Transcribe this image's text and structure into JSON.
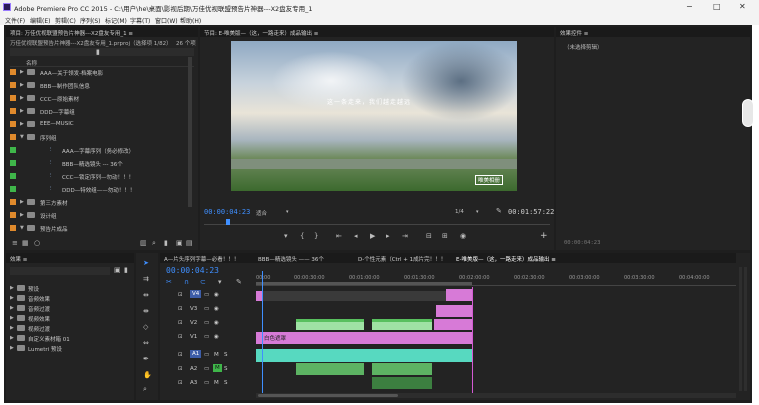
{
  "window": {
    "title": "Adobe Premiere Pro CC 2015 - C:\\用户\\he\\桌面\\影视后期\\万佳优视联盟预告片神器---X2盘友专用_1",
    "buttons": [
      "−",
      "□",
      "✕"
    ]
  },
  "menu": [
    "文件(F)",
    "编辑(E)",
    "剪辑(C)",
    "序列(S)",
    "标记(M)",
    "字幕(T)",
    "窗口(W)",
    "帮助(H)"
  ],
  "project": {
    "tab": "项目: 万佳优视联盟预告片神器---X2盘友专用_1 ≡",
    "file": "万佳优视联盟预告片神器---X2盘友专用_1.prproj（选择项 1/82）",
    "count": "26 个项",
    "column": "名称",
    "items": [
      {
        "label": "AAA—关于领发-档案电影",
        "color": "#e08a2c",
        "indent": 0
      },
      {
        "label": "BBB—制作团队信息",
        "color": "#e08a2c",
        "indent": 0
      },
      {
        "label": "CCC—原始素材",
        "color": "#e08a2c",
        "indent": 0
      },
      {
        "label": "DDD—字幕组",
        "color": "#e08a2c",
        "indent": 0
      },
      {
        "label": "EEE—MUSIC",
        "color": "#e08a2c",
        "indent": 0
      },
      {
        "label": "序列组",
        "color": "#e08a2c",
        "indent": 0
      },
      {
        "label": "AAA—字幕序列（务必修改）",
        "color": "#3fb64a",
        "indent": 1
      },
      {
        "label": "BBB—精选镜头 --- 36个",
        "color": "#3fb64a",
        "indent": 1
      },
      {
        "label": "CCC—锁定序列—勿动！！！",
        "color": "#3fb64a",
        "indent": 1
      },
      {
        "label": "DDD—特效组——勿动！！！",
        "color": "#3fb64a",
        "indent": 1
      },
      {
        "label": "第三方素材",
        "color": "#e08a2c",
        "indent": 0
      },
      {
        "label": "设计组",
        "color": "#e08a2c",
        "indent": 0
      },
      {
        "label": "预告片成品",
        "color": "#e08a2c",
        "indent": 0
      }
    ]
  },
  "program": {
    "tab": "节目: E-唯美版—（这，一路走来）成品输出 ≡",
    "overlay_text": "这一条走来，我们越走越远",
    "watermark": "唯美相册",
    "timecode": "00:00:04:23",
    "fit": "适合",
    "quality": "1/4",
    "duration": "00:01:57:22"
  },
  "effect_controls": {
    "tab": "效果控件 ≡",
    "empty": "（未选择剪辑）",
    "timecode": "00:00:04:23"
  },
  "effects": {
    "tab": "效果 ≡",
    "items": [
      "预设",
      "音频效果",
      "音频过渡",
      "视频效果",
      "视频过渡",
      "自定义素材箱 01",
      "Lumetri 预设"
    ]
  },
  "timeline": {
    "tabs": [
      "A—片头序列字幕—必看！！！",
      "BBB—精选镜头 —— 36个",
      "D-个性元素（Ctrl + 1成片完！！！",
      "E-唯美版—（这，一路走来）成品输出 ≡"
    ],
    "timecode": "00:00:04:23",
    "ruler": [
      "00:00",
      "00:00:30:00",
      "00:01:00:00",
      "00:01:30:00",
      "00:02:00:00",
      "00:02:30:00",
      "00:03:00:00",
      "00:03:30:00",
      "00:04:00:00"
    ],
    "tracks": [
      {
        "name": "V4",
        "type": "video"
      },
      {
        "name": "V3",
        "type": "video"
      },
      {
        "name": "V2",
        "type": "video"
      },
      {
        "name": "V1",
        "type": "video"
      },
      {
        "name": "A1",
        "type": "audio"
      },
      {
        "name": "A2",
        "type": "audio"
      },
      {
        "name": "A3",
        "type": "audio"
      }
    ],
    "clip_label": "白色遮罩"
  },
  "colors": {
    "panel": "#232323",
    "timecode": "#3f8fff",
    "video_clip": "#9fe2a4",
    "audio_clip": "#57d9c0",
    "adjust_clip": "#d77ad7",
    "playhead": "#3f8fff"
  }
}
